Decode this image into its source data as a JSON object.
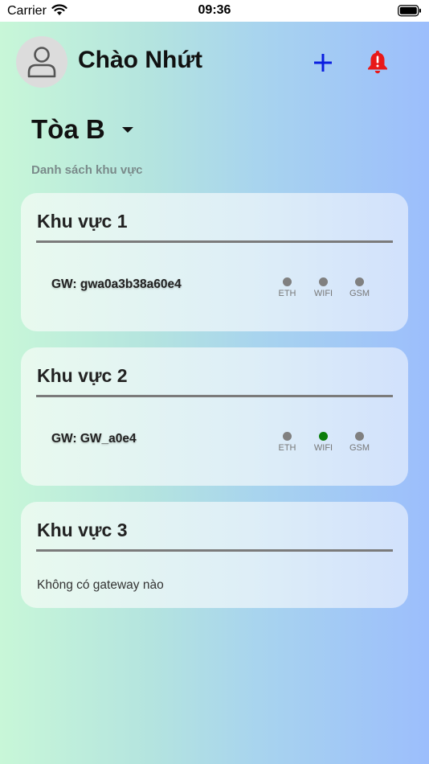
{
  "status_bar": {
    "carrier": "Carrier",
    "time": "09:36"
  },
  "header": {
    "greeting": "Chào Nhứt",
    "add_icon": "plus-icon",
    "alarm_icon": "bell-alert-icon",
    "accent_color": "#0a1ee0",
    "alarm_color": "#e81919"
  },
  "building": {
    "selected": "Tòa B"
  },
  "section_label": "Danh sách khu vực",
  "areas": [
    {
      "name": "Khu vực 1",
      "gateway": "GW: gwa0a3b38a60e4",
      "indicators": [
        {
          "label": "ETH",
          "active": false
        },
        {
          "label": "WIFI",
          "active": false
        },
        {
          "label": "GSM",
          "active": false
        }
      ]
    },
    {
      "name": "Khu vực 2",
      "gateway": "GW: GW_a0e4",
      "indicators": [
        {
          "label": "ETH",
          "active": false
        },
        {
          "label": "WIFI",
          "active": true
        },
        {
          "label": "GSM",
          "active": false
        }
      ]
    },
    {
      "name": "Khu vực 3",
      "empty_text": "Không có gateway nào"
    }
  ]
}
